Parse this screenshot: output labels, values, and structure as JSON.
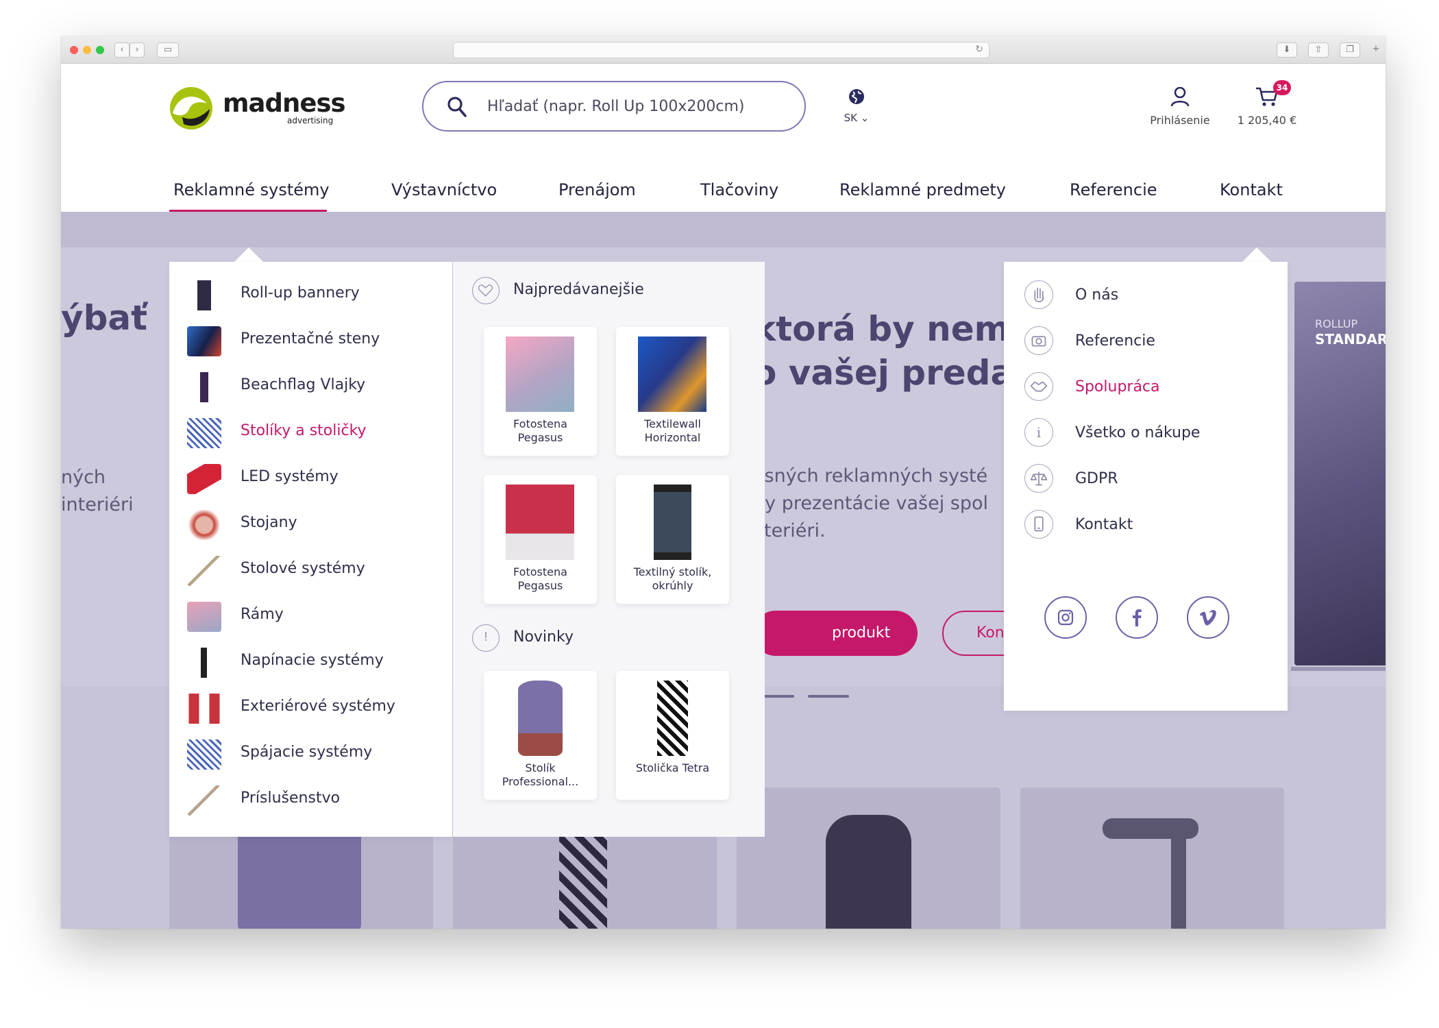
{
  "browser": {
    "traffic_lights": [
      "#fc605b",
      "#fdbc40",
      "#34c84a"
    ]
  },
  "header": {
    "logo_text": "madness",
    "logo_sub": "advertising",
    "search_placeholder": "Hľadať (napr. Roll Up 100x200cm)",
    "language": "SK",
    "account_label": "Prihlásenie",
    "cart_count": "34",
    "cart_total": "1 205,40 €"
  },
  "nav": {
    "items": [
      {
        "label": "Reklamné systémy",
        "active": true
      },
      {
        "label": "Výstavníctvo"
      },
      {
        "label": "Prenájom"
      },
      {
        "label": "Tlačoviny"
      },
      {
        "label": "Reklamné predmety"
      },
      {
        "label": "Referencie"
      },
      {
        "label": "Kontakt"
      }
    ]
  },
  "hero": {
    "left_line1": "ýbať",
    "left_sub1": "ných",
    "left_sub2": "interiéri",
    "headline_line1": "ktorá by nema",
    "headline_line2": "o vašej predaj",
    "sub_line1": "osných reklamných systé",
    "sub_line2": "py prezentácie vašej spol",
    "sub_line3": "xteriéri.",
    "btn_primary": "produkt",
    "btn_secondary": "Kontaktujte",
    "banner_small": "ROLLUP",
    "banner_big": "STANDAR"
  },
  "categories": [
    {
      "label": "Roll-up bannery",
      "icon": "rollup-icon"
    },
    {
      "label": "Prezentačné steny",
      "icon": "wall-icon"
    },
    {
      "label": "Beachflag Vlajky",
      "icon": "flag-icon"
    },
    {
      "label": "Stolíky a stoličky",
      "icon": "table-icon",
      "active": true
    },
    {
      "label": "LED systémy",
      "icon": "led-icon"
    },
    {
      "label": "Stojany",
      "icon": "stand-icon"
    },
    {
      "label": "Stolové systémy",
      "icon": "desk-icon"
    },
    {
      "label": "Rámy",
      "icon": "frame-icon"
    },
    {
      "label": "Napínacie systémy",
      "icon": "tension-icon"
    },
    {
      "label": "Exteriérové systémy",
      "icon": "exterior-icon"
    },
    {
      "label": "Spájacie systémy",
      "icon": "connect-icon"
    },
    {
      "label": "Príslušenstvo",
      "icon": "accessory-icon"
    }
  ],
  "bestsellers": {
    "title": "Najpredávanejšie",
    "items": [
      {
        "name": "Fotostena Pegasus"
      },
      {
        "name": "Textilewall Horizontal"
      },
      {
        "name": "Fotostena Pegasus"
      },
      {
        "name": "Textilný stolík, okrúhly"
      }
    ]
  },
  "news": {
    "title": "Novinky",
    "items": [
      {
        "name": "Stolík Professional..."
      },
      {
        "name": "Stolička Tetra"
      }
    ]
  },
  "contact_menu": {
    "items": [
      {
        "label": "O nás",
        "icon": "hand-icon"
      },
      {
        "label": "Referencie",
        "icon": "camera-icon"
      },
      {
        "label": "Spolupráca",
        "icon": "handshake-icon",
        "active": true
      },
      {
        "label": "Všetko o nákupe",
        "icon": "info-icon"
      },
      {
        "label": "GDPR",
        "icon": "scales-icon"
      },
      {
        "label": "Kontakt",
        "icon": "phone-icon"
      }
    ],
    "social": [
      "instagram-icon",
      "facebook-icon",
      "vimeo-icon"
    ]
  },
  "colors": {
    "accent": "#c5186a",
    "brand_green": "#a9c20e",
    "outline": "#7d78b6"
  }
}
